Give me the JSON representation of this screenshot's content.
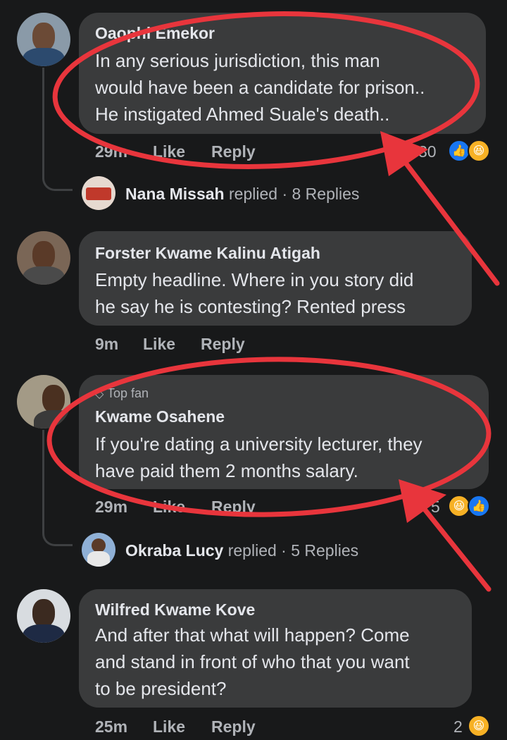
{
  "comments": [
    {
      "author": "Oaophi Emekor",
      "lines": [
        "In any serious jurisdiction, this man",
        "would have been a candidate for prison..",
        "He instigated Ahmed Suale's death.."
      ],
      "time": "29m",
      "like": "Like",
      "reply": "Reply",
      "reactions": "30",
      "reply_summary": {
        "name": "Nana Missah",
        "verb": "replied",
        "count": "· 8 Replies"
      }
    },
    {
      "author": "Forster Kwame Kalinu Atigah",
      "lines": [
        "Empty headline. Where in you story did",
        "he say he is contesting? Rented press"
      ],
      "time": "9m",
      "like": "Like",
      "reply": "Reply"
    },
    {
      "badge": "Top fan",
      "author": "Kwame Osahene",
      "lines": [
        "If you're dating a university lecturer, they",
        "have paid them 2 months salary."
      ],
      "time": "29m",
      "like": "Like",
      "reply": "Reply",
      "reactions": "5",
      "reply_summary": {
        "name": "Okraba Lucy",
        "verb": "replied",
        "count": "· 5 Replies"
      }
    },
    {
      "author": "Wilfred Kwame Kove",
      "lines": [
        "And after that what will happen? Come",
        "and stand in front of who that you want",
        "to be president?"
      ],
      "time": "25m",
      "like": "Like",
      "reply": "Reply",
      "reactions": "2"
    }
  ],
  "icons": {
    "like": "like-reaction-icon",
    "haha": "haha-reaction-icon",
    "diamond": "top-fan-diamond-icon"
  },
  "colors": {
    "annotation": "#e8353c",
    "like": "#1877f2",
    "haha": "#f7b125"
  }
}
